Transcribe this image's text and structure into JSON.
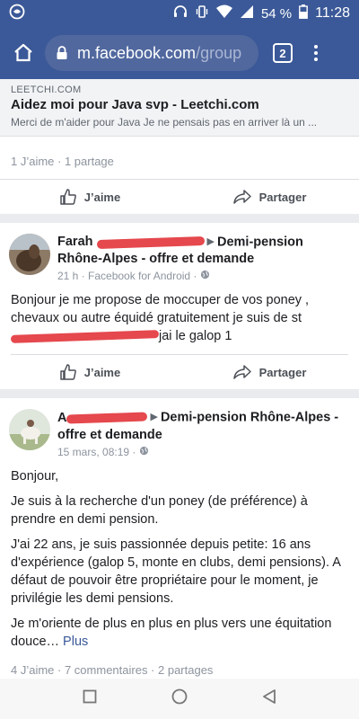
{
  "status_bar": {
    "battery": "54 %",
    "time": "11:28"
  },
  "browser": {
    "url_host": "m.facebook.com",
    "url_path": "/group",
    "tab_count": "2"
  },
  "prev_post": {
    "link_domain": "LEETCHI.COM",
    "link_title": "Aidez moi pour Java svp - Leetchi.com",
    "link_desc": "Merci de m'aider pour Java Je ne pensais pas en arriver là un ...",
    "stats": "1 J’aime · 1 partage",
    "like_label": "J’aime",
    "share_label": "Partager"
  },
  "post1": {
    "author_visible": "Farah",
    "group": "Demi-pension Rhône-Alpes - offre et demande",
    "time": "21 h · Facebook for Android ·",
    "body_line1": "Bonjour je me propose de moccuper de vos poney , chevaux ou autre équidé gratuitement je suis de st",
    "body_line2_end": "jai le galop 1",
    "like_label": "J’aime",
    "share_label": "Partager"
  },
  "post2": {
    "author_visible": "A",
    "group": "Demi-pension Rhône-Alpes - offre et demande",
    "time": "15 mars, 08:19 ·",
    "p1": "Bonjour,",
    "p2": "Je suis à la recherche d'un poney (de préférence) à prendre en demi pension.",
    "p3": "J'ai 22 ans, je suis passionnée depuis petite: 16 ans d'expérience (galop 5, monte en clubs, demi pensions). A défaut de pouvoir être propriétaire pour le moment, je privilégie les demi pensions.",
    "p4": "Je m'oriente de plus en plus en plus vers une équitation douce…",
    "more": "Plus",
    "stats": "4 J’aime · 7 commentaires · 2 partages"
  },
  "colors": {
    "facebook_blue": "#3b5998",
    "redaction_red": "#e5484d"
  }
}
